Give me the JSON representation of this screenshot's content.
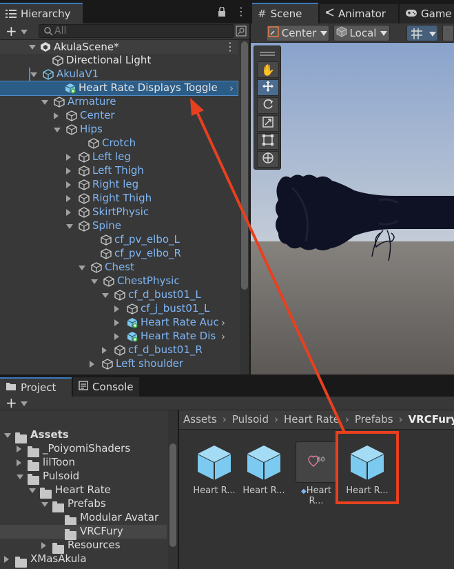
{
  "hierarchy": {
    "tab_label": "Hierarchy",
    "search_placeholder": "All",
    "scene_name": "AkulaScene*",
    "items": [
      {
        "label": "Directional Light"
      },
      {
        "label": "AkulaV1"
      },
      {
        "label": "Heart Rate Displays Toggle"
      },
      {
        "label": "Armature"
      },
      {
        "label": "Center"
      },
      {
        "label": "Hips"
      },
      {
        "label": "Crotch"
      },
      {
        "label": "Left leg"
      },
      {
        "label": "Left Thigh"
      },
      {
        "label": "Right leg"
      },
      {
        "label": "Right Thigh"
      },
      {
        "label": "SkirtPhysic"
      },
      {
        "label": "Spine"
      },
      {
        "label": "cf_pv_elbo_L"
      },
      {
        "label": "cf_pv_elbo_R"
      },
      {
        "label": "Chest"
      },
      {
        "label": "ChestPhysic"
      },
      {
        "label": "cf_d_bust01_L"
      },
      {
        "label": "cf_j_bust01_L"
      },
      {
        "label": "Heart Rate Auc"
      },
      {
        "label": "Heart Rate Dis"
      },
      {
        "label": "cf_d_bust01_R"
      },
      {
        "label": "Left shoulder"
      }
    ]
  },
  "scene": {
    "tabs": [
      {
        "label": "Scene"
      },
      {
        "label": "Animator"
      },
      {
        "label": "Game"
      }
    ],
    "pivot_label": "Center",
    "space_label": "Local"
  },
  "project": {
    "tabs": [
      {
        "label": "Project"
      },
      {
        "label": "Console"
      }
    ],
    "tree": [
      {
        "label": "Assets"
      },
      {
        "label": "_PoiyomiShaders"
      },
      {
        "label": "lilToon"
      },
      {
        "label": "Pulsoid"
      },
      {
        "label": "Heart Rate"
      },
      {
        "label": "Prefabs"
      },
      {
        "label": "Modular Avatar"
      },
      {
        "label": "VRCFury"
      },
      {
        "label": "Resources"
      },
      {
        "label": "XMasAkula"
      }
    ],
    "breadcrumb": [
      "Assets",
      "Pulsoid",
      "Heart Rate",
      "Prefabs",
      "VRCFury"
    ],
    "assets": [
      {
        "label": "Heart R..."
      },
      {
        "label": "Heart R..."
      },
      {
        "label": "Heart R..."
      },
      {
        "label": "Heart R..."
      }
    ]
  },
  "colors": {
    "selection": "#2c5d87",
    "annotation": "#e8401f",
    "accent_blue": "#7fb6f5"
  }
}
